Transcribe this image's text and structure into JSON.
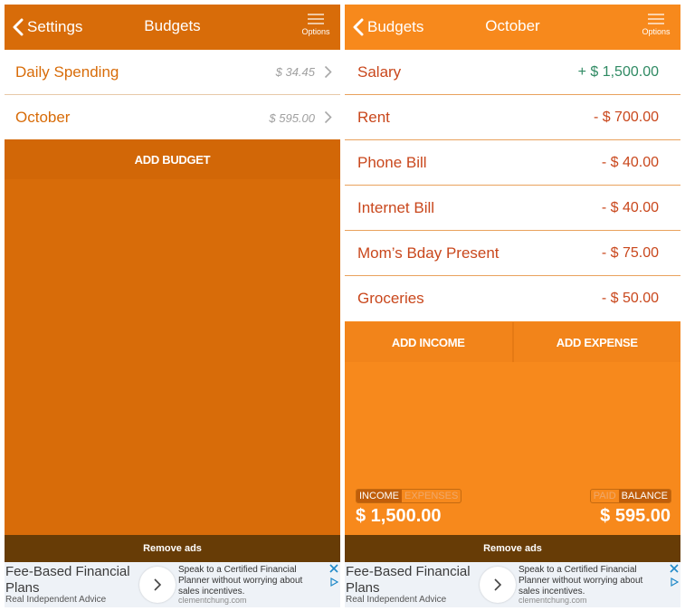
{
  "left": {
    "nav": {
      "back_label": "Settings",
      "title": "Budgets",
      "options_label": "Options"
    },
    "rows": [
      {
        "label": "Daily Spending",
        "amount": "$ 34.45"
      },
      {
        "label": "October",
        "amount": "$ 595.00"
      }
    ],
    "add_budget_label": "ADD BUDGET",
    "remove_ads_label": "Remove ads"
  },
  "right": {
    "nav": {
      "back_label": "Budgets",
      "title": "October",
      "options_label": "Options"
    },
    "rows": [
      {
        "label": "Salary",
        "amount": "+ $ 1,500.00",
        "kind": "income"
      },
      {
        "label": "Rent",
        "amount": "- $ 700.00",
        "kind": "expense"
      },
      {
        "label": "Phone Bill",
        "amount": "- $ 40.00",
        "kind": "expense"
      },
      {
        "label": "Internet Bill",
        "amount": "- $ 40.00",
        "kind": "expense"
      },
      {
        "label": "Mom’s Bday Present",
        "amount": "- $ 75.00",
        "kind": "expense"
      },
      {
        "label": "Groceries",
        "amount": "- $ 50.00",
        "kind": "expense"
      }
    ],
    "add_income_label": "ADD INCOME",
    "add_expense_label": "ADD EXPENSE",
    "summary": {
      "left_toggle": {
        "income": "INCOME",
        "expenses": "EXPENSES",
        "selected": "income"
      },
      "left_amount": "$ 1,500.00",
      "right_toggle": {
        "paid": "PAID",
        "balance": "BALANCE",
        "selected": "balance"
      },
      "right_amount": "$ 595.00"
    },
    "remove_ads_label": "Remove ads"
  },
  "ad": {
    "headline": "Fee-Based Financial Plans",
    "subline": "Real Independent Advice",
    "body": "Speak to a Certified Financial Planner without worrying about sales incentives.",
    "url": "clementchung.com"
  },
  "colors": {
    "left_theme": "#d86c09",
    "right_theme": "#f7891c",
    "income_text": "#2f8a63",
    "expense_text": "#c9471c",
    "remove_ads_bar": "#673c06"
  },
  "icons": [
    "back-chevron-icon",
    "menu-icon",
    "chevron-right-icon",
    "ad-arrow-icon",
    "ad-close-icon",
    "ad-choices-icon"
  ]
}
